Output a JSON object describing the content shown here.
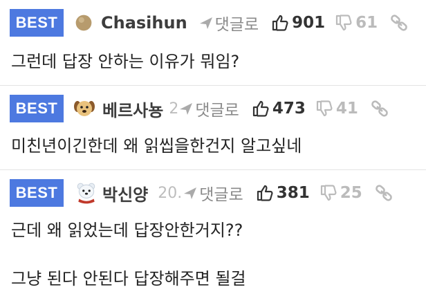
{
  "reply_label": "댓글로",
  "comments": [
    {
      "badge": "BEST",
      "nickname": "Chasihun",
      "time": "",
      "likes": "901",
      "dislikes": "61",
      "lines": [
        "그런데 답장 안하는 이유가 뭐임?"
      ]
    },
    {
      "badge": "BEST",
      "nickname": "베르사뇽",
      "time": "2",
      "likes": "473",
      "dislikes": "41",
      "lines": [
        "미친년이긴한데 왜 읽씹을한건지 알고싶네"
      ]
    },
    {
      "badge": "BEST",
      "nickname": "박신양",
      "time": "20.",
      "likes": "381",
      "dislikes": "25",
      "lines": [
        "근데 왜 읽었는데 답장안한거지??",
        "그냥 된다 안된다 답장해주면 될걸"
      ]
    }
  ],
  "colors": {
    "best_badge": "#4d79e0",
    "divider": "#e3e3e3"
  }
}
